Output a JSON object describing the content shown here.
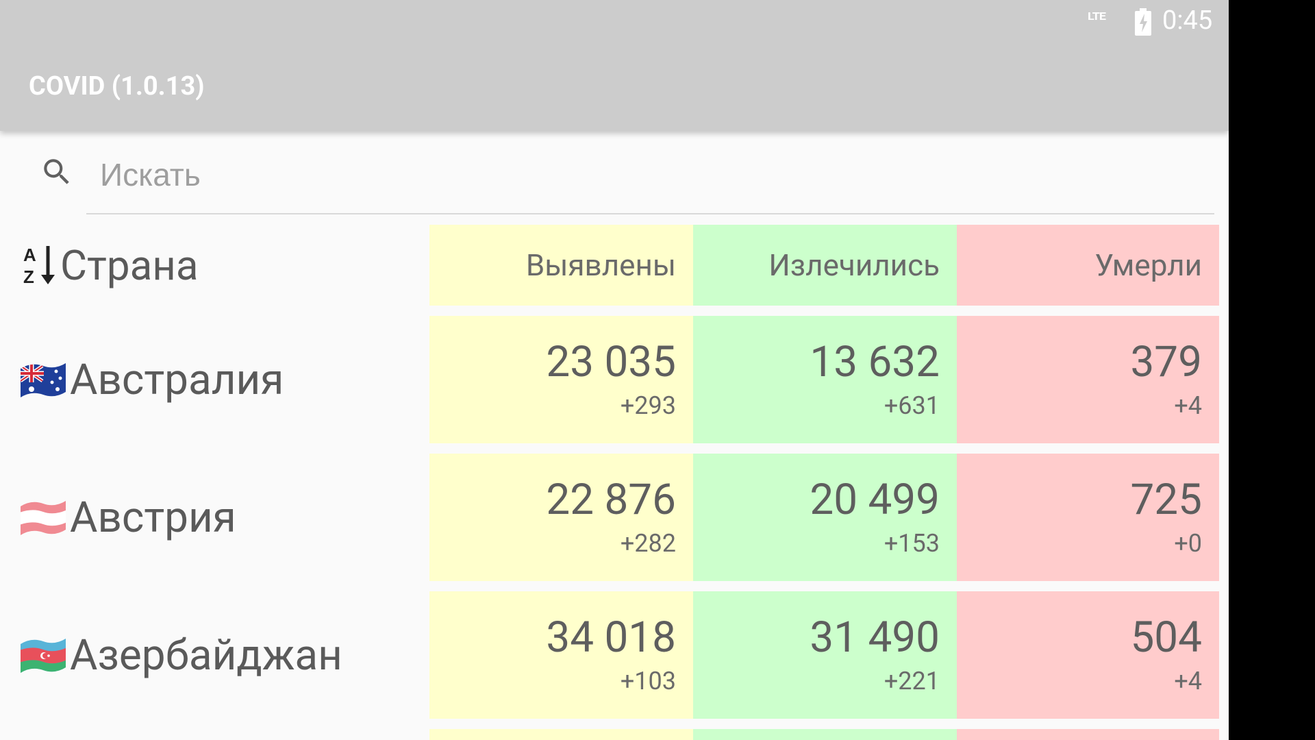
{
  "status_bar": {
    "network": "LTE",
    "time": "0:45"
  },
  "app_bar": {
    "title": "COVID (1.0.13)"
  },
  "search": {
    "placeholder": "Искать",
    "value": ""
  },
  "table": {
    "headers": {
      "country": "Страна",
      "confirmed": "Выявлены",
      "recovered": "Излечились",
      "deaths": "Умерли"
    },
    "rows": [
      {
        "country": "Австралия",
        "flag": "australia-flag-icon",
        "confirmed": "23 035",
        "confirmed_delta": "+293",
        "recovered": "13 632",
        "recovered_delta": "+631",
        "deaths": "379",
        "deaths_delta": "+4"
      },
      {
        "country": "Австрия",
        "flag": "austria-flag-icon",
        "confirmed": "22 876",
        "confirmed_delta": "+282",
        "recovered": "20 499",
        "recovered_delta": "+153",
        "deaths": "725",
        "deaths_delta": "+0"
      },
      {
        "country": "Азербайджан",
        "flag": "azerbaijan-flag-icon",
        "confirmed": "34 018",
        "confirmed_delta": "+103",
        "recovered": "31 490",
        "recovered_delta": "+221",
        "deaths": "504",
        "deaths_delta": "+4"
      }
    ]
  },
  "colors": {
    "app_bar": "#cccccc",
    "confirmed": "#ffffcc",
    "recovered": "#ccffcc",
    "deaths": "#ffcccc"
  }
}
